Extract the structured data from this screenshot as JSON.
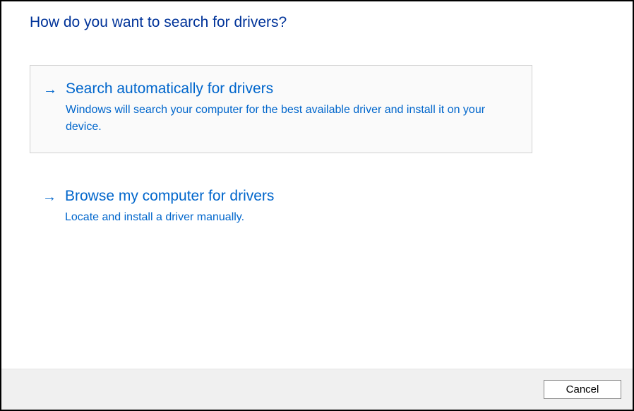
{
  "heading": "How do you want to search for drivers?",
  "options": [
    {
      "title": "Search automatically for drivers",
      "description": "Windows will search your computer for the best available driver and install it on your device."
    },
    {
      "title": "Browse my computer for drivers",
      "description": "Locate and install a driver manually."
    }
  ],
  "footer": {
    "cancel_label": "Cancel"
  }
}
